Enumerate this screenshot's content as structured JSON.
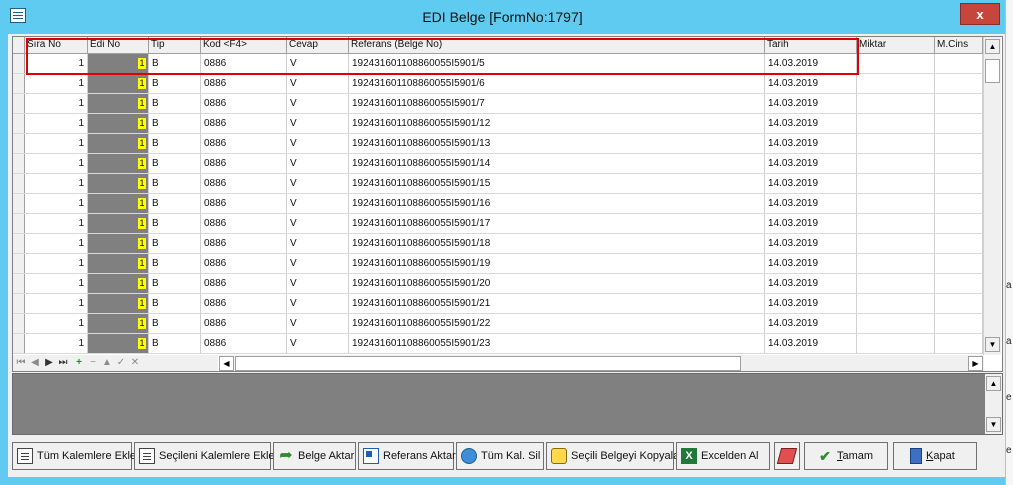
{
  "window": {
    "title": "EDI Belge  [FormNo:1797]",
    "close_label": "x"
  },
  "grid": {
    "columns": [
      "Sıra No",
      "Edi No",
      "Tip",
      "Kod <F4>",
      "Cevap",
      "Referans (Belge No)",
      "Tarih",
      "Miktar",
      "M.Cins"
    ],
    "rows": [
      {
        "sira": "1",
        "edi": "1",
        "tip": "B",
        "kod": "0886",
        "cevap": "V",
        "ref": "192431601108860055I5901/5",
        "tarih": "14.03.2019"
      },
      {
        "sira": "1",
        "edi": "1",
        "tip": "B",
        "kod": "0886",
        "cevap": "V",
        "ref": "192431601108860055I5901/6",
        "tarih": "14.03.2019"
      },
      {
        "sira": "1",
        "edi": "1",
        "tip": "B",
        "kod": "0886",
        "cevap": "V",
        "ref": "192431601108860055I5901/7",
        "tarih": "14.03.2019"
      },
      {
        "sira": "1",
        "edi": "1",
        "tip": "B",
        "kod": "0886",
        "cevap": "V",
        "ref": "192431601108860055I5901/12",
        "tarih": "14.03.2019"
      },
      {
        "sira": "1",
        "edi": "1",
        "tip": "B",
        "kod": "0886",
        "cevap": "V",
        "ref": "192431601108860055I5901/13",
        "tarih": "14.03.2019"
      },
      {
        "sira": "1",
        "edi": "1",
        "tip": "B",
        "kod": "0886",
        "cevap": "V",
        "ref": "192431601108860055I5901/14",
        "tarih": "14.03.2019"
      },
      {
        "sira": "1",
        "edi": "1",
        "tip": "B",
        "kod": "0886",
        "cevap": "V",
        "ref": "192431601108860055I5901/15",
        "tarih": "14.03.2019"
      },
      {
        "sira": "1",
        "edi": "1",
        "tip": "B",
        "kod": "0886",
        "cevap": "V",
        "ref": "192431601108860055I5901/16",
        "tarih": "14.03.2019"
      },
      {
        "sira": "1",
        "edi": "1",
        "tip": "B",
        "kod": "0886",
        "cevap": "V",
        "ref": "192431601108860055I5901/17",
        "tarih": "14.03.2019"
      },
      {
        "sira": "1",
        "edi": "1",
        "tip": "B",
        "kod": "0886",
        "cevap": "V",
        "ref": "192431601108860055I5901/18",
        "tarih": "14.03.2019"
      },
      {
        "sira": "1",
        "edi": "1",
        "tip": "B",
        "kod": "0886",
        "cevap": "V",
        "ref": "192431601108860055I5901/19",
        "tarih": "14.03.2019"
      },
      {
        "sira": "1",
        "edi": "1",
        "tip": "B",
        "kod": "0886",
        "cevap": "V",
        "ref": "192431601108860055I5901/20",
        "tarih": "14.03.2019"
      },
      {
        "sira": "1",
        "edi": "1",
        "tip": "B",
        "kod": "0886",
        "cevap": "V",
        "ref": "192431601108860055I5901/21",
        "tarih": "14.03.2019"
      },
      {
        "sira": "1",
        "edi": "1",
        "tip": "B",
        "kod": "0886",
        "cevap": "V",
        "ref": "192431601108860055I5901/22",
        "tarih": "14.03.2019"
      },
      {
        "sira": "1",
        "edi": "1",
        "tip": "B",
        "kod": "0886",
        "cevap": "V",
        "ref": "192431601108860055I5901/23",
        "tarih": "14.03.2019"
      }
    ]
  },
  "navigator": {
    "items": [
      "⏮",
      "◀",
      "▶",
      "⏭",
      "+",
      "−",
      "▲",
      "✓",
      "✕"
    ]
  },
  "buttons": {
    "tum_kalemlere_ekle": "Tüm Kalemlere Ekle",
    "secileni_kalemlere_ekle": "Seçileni Kalemlere Ekle",
    "belge_aktar": "Belge Aktar",
    "referans_aktar": "Referans Aktar",
    "tum_kal_sil": "Tüm Kal. Sil",
    "secili_belgeyi_kopyala": "Seçili Belgeyi Kopyala",
    "excelden_al": "Excelden Al",
    "tamam": "Tamam",
    "kapat": "Kapat"
  },
  "side_chars": [
    "a",
    "a",
    "e",
    "e"
  ],
  "colors": {
    "titlebar": "#5fcbf0",
    "close": "#c7463c",
    "highlight": "#e00000",
    "edi_column": "#808080",
    "edi_value": "#ffff00"
  }
}
